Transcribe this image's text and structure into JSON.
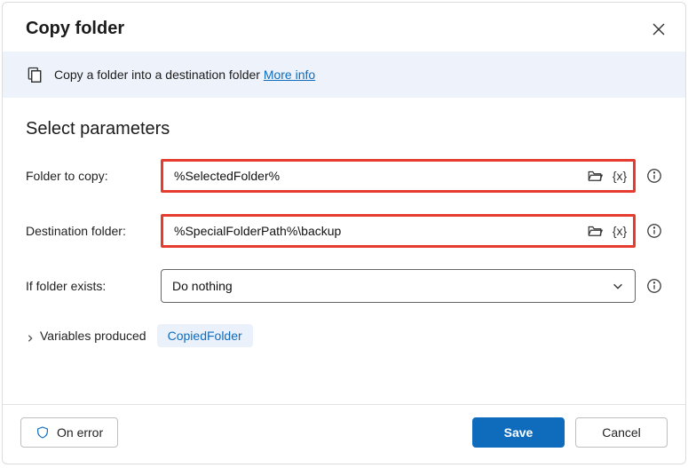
{
  "title": "Copy folder",
  "info": {
    "text": "Copy a folder into a destination folder ",
    "link_label": "More info"
  },
  "section_heading": "Select parameters",
  "fields": {
    "folder_to_copy": {
      "label": "Folder to copy:",
      "value": "%SelectedFolder%"
    },
    "destination_folder": {
      "label": "Destination folder:",
      "value": "%SpecialFolderPath%\\backup"
    },
    "if_exists": {
      "label": "If folder exists:",
      "value": "Do nothing"
    }
  },
  "variables_produced": {
    "label": "Variables produced",
    "chip": "CopiedFolder"
  },
  "footer": {
    "on_error": "On error",
    "save": "Save",
    "cancel": "Cancel"
  }
}
